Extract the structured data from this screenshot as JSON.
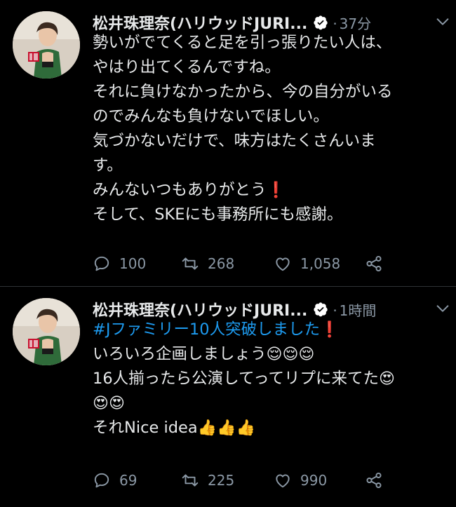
{
  "tweets": [
    {
      "author_name": "松井珠理奈(ハリウッドJURI...",
      "time_label": "37分",
      "body_lines": [
        "勢いがでてくると足を引っ張りたい人は、",
        "やはり出てくるんですね。",
        "それに負けなかったから、今の自分がいる",
        "のでみんなも負けないでほしい。",
        "気づかないだけで、味方はたくさんいま",
        "す。",
        "みんないつもありがとう",
        "そして、SKEにも事務所にも感謝。"
      ],
      "emoji_exclamation": "❗",
      "reply_count": "100",
      "retweet_count": "268",
      "like_count": "1,058"
    },
    {
      "author_name": "松井珠理奈(ハリウッドJURI...",
      "time_label": "1時間",
      "hashtag": "#Jファミリー10人突破しました",
      "emoji_exclamation": "❗",
      "body_lines": [
        "いろいろ企画しましょう",
        "16人揃ったら公演してってリプに来てた",
        "それNice idea"
      ],
      "emoji_relieved": "😌",
      "emoji_heart_eyes": "😍",
      "emoji_thumbs": "👍",
      "reply_count": "69",
      "retweet_count": "225",
      "like_count": "990"
    }
  ],
  "colors": {
    "background": "#000000",
    "text": "#e7e9ea",
    "secondary": "#8b98a5",
    "link": "#1d9bf0",
    "verified": "#ffffff",
    "divider": "#2f3336"
  },
  "icons": [
    "reply-icon",
    "retweet-icon",
    "like-icon",
    "share-icon",
    "verified-icon",
    "chevron-down-icon"
  ]
}
